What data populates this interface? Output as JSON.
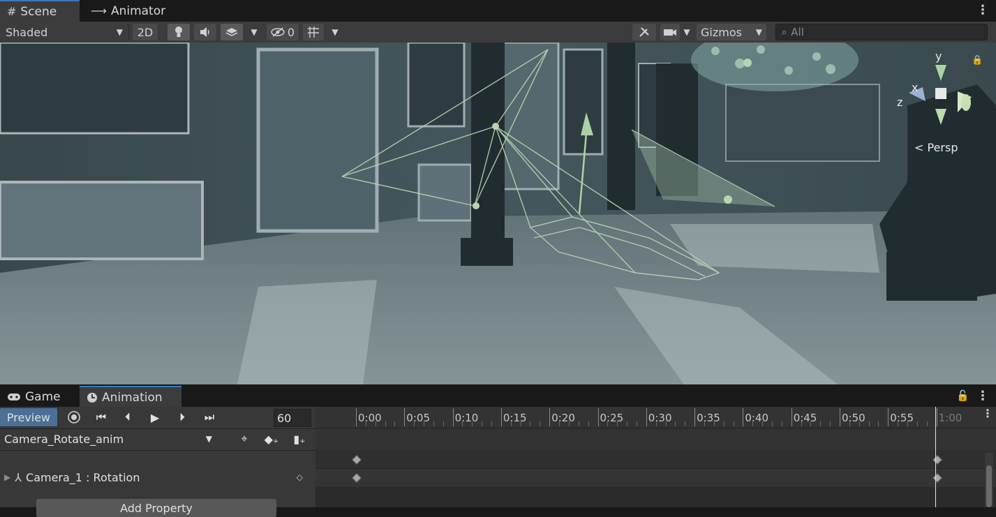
{
  "top_tabs": [
    {
      "icon": "#",
      "label": "Scene"
    },
    {
      "icon": "⟶",
      "label": "Animator"
    }
  ],
  "scene_toolbar": {
    "shading_mode": "Shaded",
    "mode_2d": "2D",
    "hidden_count": "0",
    "gizmos_label": "Gizmos",
    "search_placeholder": "All"
  },
  "scene_overlay": {
    "axis_y": "y",
    "axis_x": "x",
    "axis_z": "z",
    "projection": "Persp"
  },
  "bottom_tabs": [
    {
      "icon": "gamepad",
      "label": "Game"
    },
    {
      "icon": "clock",
      "label": "Animation"
    }
  ],
  "animation": {
    "preview_label": "Preview",
    "sample_rate": "60",
    "clip_name": "Camera_Rotate_anim",
    "property_label": "Camera_1 : Rotation",
    "add_property_label": "Add Property",
    "ruler_labels": [
      "0:00",
      "0:05",
      "0:10",
      "0:15",
      "0:20",
      "0:25",
      "0:30",
      "0:35",
      "0:40",
      "0:45",
      "0:50",
      "0:55",
      "1:00"
    ]
  },
  "colors": {
    "accent": "#3a79bb",
    "gizmo_green": "#c8f0b8",
    "scene_tint": "#4a5c62"
  }
}
